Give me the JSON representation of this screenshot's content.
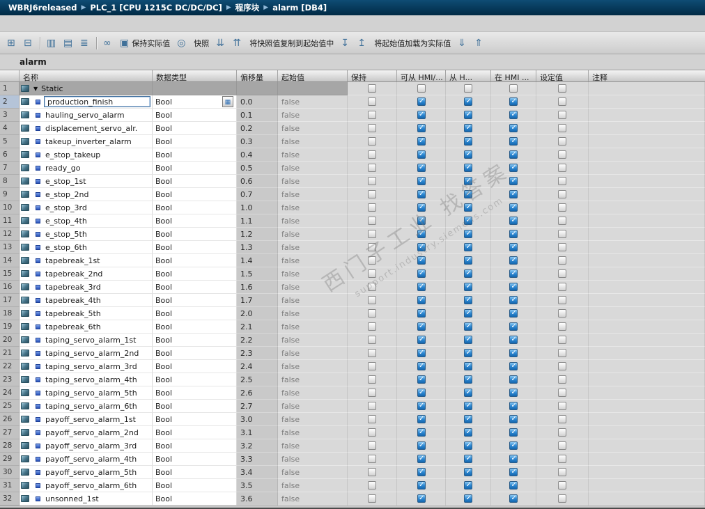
{
  "breadcrumb": {
    "items": [
      "WBRJ6released",
      "PLC_1 [CPU 1215C DC/DC/DC]",
      "程序块",
      "alarm [DB4]"
    ],
    "separator": "▶"
  },
  "toolbar": {
    "items": [
      {
        "kind": "icon",
        "name": "insert-row-icon",
        "glyph": "⊞"
      },
      {
        "kind": "icon",
        "name": "append-row-icon",
        "glyph": "⊟"
      },
      {
        "kind": "sep"
      },
      {
        "kind": "icon",
        "name": "reset-start-values-icon",
        "glyph": "▥"
      },
      {
        "kind": "icon",
        "name": "update-interface-icon",
        "glyph": "▤"
      },
      {
        "kind": "icon",
        "name": "expanded-mode-icon",
        "glyph": "≣"
      },
      {
        "kind": "sep"
      },
      {
        "kind": "icon",
        "name": "monitor-all-icon",
        "glyph": "∞"
      },
      {
        "kind": "button",
        "name": "keep-actual-values-button",
        "glyph": "▣",
        "label": "保持实际值"
      },
      {
        "kind": "icon",
        "name": "snapshot-camera-icon",
        "glyph": "◎"
      },
      {
        "kind": "button",
        "name": "snapshot-button",
        "label": "快照"
      },
      {
        "kind": "icon",
        "name": "copy-snapshot-down-icon",
        "glyph": "⇊"
      },
      {
        "kind": "icon",
        "name": "copy-snapshot-up-icon",
        "glyph": "⇈"
      },
      {
        "kind": "button",
        "name": "copy-snapshot-to-start-button",
        "label": "将快照值复制到起始值中"
      },
      {
        "kind": "icon",
        "name": "load-start-down-icon",
        "glyph": "↧"
      },
      {
        "kind": "icon",
        "name": "load-start-up-icon",
        "glyph": "↥"
      },
      {
        "kind": "button",
        "name": "load-start-as-actual-button",
        "label": "将起始值加载为实际值"
      },
      {
        "kind": "icon",
        "name": "download-values-icon",
        "glyph": "⇓"
      },
      {
        "kind": "icon",
        "name": "upload-values-icon",
        "glyph": "⇑"
      }
    ]
  },
  "title": "alarm",
  "table": {
    "header": {
      "name": "名称",
      "datatype": "数据类型",
      "offset": "偏移量",
      "start_value": "起始值",
      "retain": "保持",
      "hmi_accessible": "可从 HMI/...",
      "hmi_writable": "从 H...",
      "hmi_visible": "在 HMI ...",
      "setpoint": "设定值",
      "comment": "注释"
    },
    "group_row": {
      "num": "1",
      "label": "Static"
    },
    "selected_row": "2",
    "checkbox_columns": [
      {
        "key": "retain",
        "col": "col-retain",
        "checked": false
      },
      {
        "key": "hmi-accessible",
        "col": "col-hmi1",
        "checked": true
      },
      {
        "key": "hmi-writable",
        "col": "col-hmi2",
        "checked": true
      },
      {
        "key": "hmi-visible",
        "col": "col-hmi3",
        "checked": true
      },
      {
        "key": "setpoint",
        "col": "col-setpoint",
        "checked": false
      }
    ],
    "rows": [
      {
        "num": "2",
        "name": "production_finish",
        "type": "Bool",
        "offset": "0.0",
        "start": "false"
      },
      {
        "num": "3",
        "name": "hauling_servo_alarm",
        "type": "Bool",
        "offset": "0.1",
        "start": "false"
      },
      {
        "num": "4",
        "name": "displacement_servo_alr.",
        "type": "Bool",
        "offset": "0.2",
        "start": "false"
      },
      {
        "num": "5",
        "name": "takeup_inverter_alarm",
        "type": "Bool",
        "offset": "0.3",
        "start": "false"
      },
      {
        "num": "6",
        "name": "e_stop_takeup",
        "type": "Bool",
        "offset": "0.4",
        "start": "false"
      },
      {
        "num": "7",
        "name": "ready_go",
        "type": "Bool",
        "offset": "0.5",
        "start": "false"
      },
      {
        "num": "8",
        "name": "e_stop_1st",
        "type": "Bool",
        "offset": "0.6",
        "start": "false"
      },
      {
        "num": "9",
        "name": "e_stop_2nd",
        "type": "Bool",
        "offset": "0.7",
        "start": "false"
      },
      {
        "num": "10",
        "name": "e_stop_3rd",
        "type": "Bool",
        "offset": "1.0",
        "start": "false"
      },
      {
        "num": "11",
        "name": "e_stop_4th",
        "type": "Bool",
        "offset": "1.1",
        "start": "false"
      },
      {
        "num": "12",
        "name": "e_stop_5th",
        "type": "Bool",
        "offset": "1.2",
        "start": "false"
      },
      {
        "num": "13",
        "name": "e_stop_6th",
        "type": "Bool",
        "offset": "1.3",
        "start": "false"
      },
      {
        "num": "14",
        "name": "tapebreak_1st",
        "type": "Bool",
        "offset": "1.4",
        "start": "false"
      },
      {
        "num": "15",
        "name": "tapebreak_2nd",
        "type": "Bool",
        "offset": "1.5",
        "start": "false"
      },
      {
        "num": "16",
        "name": "tapebreak_3rd",
        "type": "Bool",
        "offset": "1.6",
        "start": "false"
      },
      {
        "num": "17",
        "name": "tapebreak_4th",
        "type": "Bool",
        "offset": "1.7",
        "start": "false"
      },
      {
        "num": "18",
        "name": "tapebreak_5th",
        "type": "Bool",
        "offset": "2.0",
        "start": "false"
      },
      {
        "num": "19",
        "name": "tapebreak_6th",
        "type": "Bool",
        "offset": "2.1",
        "start": "false"
      },
      {
        "num": "20",
        "name": "taping_servo_alarm_1st",
        "type": "Bool",
        "offset": "2.2",
        "start": "false"
      },
      {
        "num": "21",
        "name": "taping_servo_alarm_2nd",
        "type": "Bool",
        "offset": "2.3",
        "start": "false"
      },
      {
        "num": "22",
        "name": "taping_servo_alarm_3rd",
        "type": "Bool",
        "offset": "2.4",
        "start": "false"
      },
      {
        "num": "23",
        "name": "taping_servo_alarm_4th",
        "type": "Bool",
        "offset": "2.5",
        "start": "false"
      },
      {
        "num": "24",
        "name": "taping_servo_alarm_5th",
        "type": "Bool",
        "offset": "2.6",
        "start": "false"
      },
      {
        "num": "25",
        "name": "taping_servo_alarm_6th",
        "type": "Bool",
        "offset": "2.7",
        "start": "false"
      },
      {
        "num": "26",
        "name": "payoff_servo_alarm_1st",
        "type": "Bool",
        "offset": "3.0",
        "start": "false"
      },
      {
        "num": "27",
        "name": "payoff_servo_alarm_2nd",
        "type": "Bool",
        "offset": "3.1",
        "start": "false"
      },
      {
        "num": "28",
        "name": "payoff_servo_alarm_3rd",
        "type": "Bool",
        "offset": "3.2",
        "start": "false"
      },
      {
        "num": "29",
        "name": "payoff_servo_alarm_4th",
        "type": "Bool",
        "offset": "3.3",
        "start": "false"
      },
      {
        "num": "30",
        "name": "payoff_servo_alarm_5th",
        "type": "Bool",
        "offset": "3.4",
        "start": "false"
      },
      {
        "num": "31",
        "name": "payoff_servo_alarm_6th",
        "type": "Bool",
        "offset": "3.5",
        "start": "false"
      },
      {
        "num": "32",
        "name": "unsonned_1st",
        "type": "Bool",
        "offset": "3.6",
        "start": "false"
      }
    ],
    "picker_glyph": "▦"
  },
  "watermark": {
    "line1": "西门子工业 找答案",
    "line2": "support.industry.siemens.com"
  }
}
